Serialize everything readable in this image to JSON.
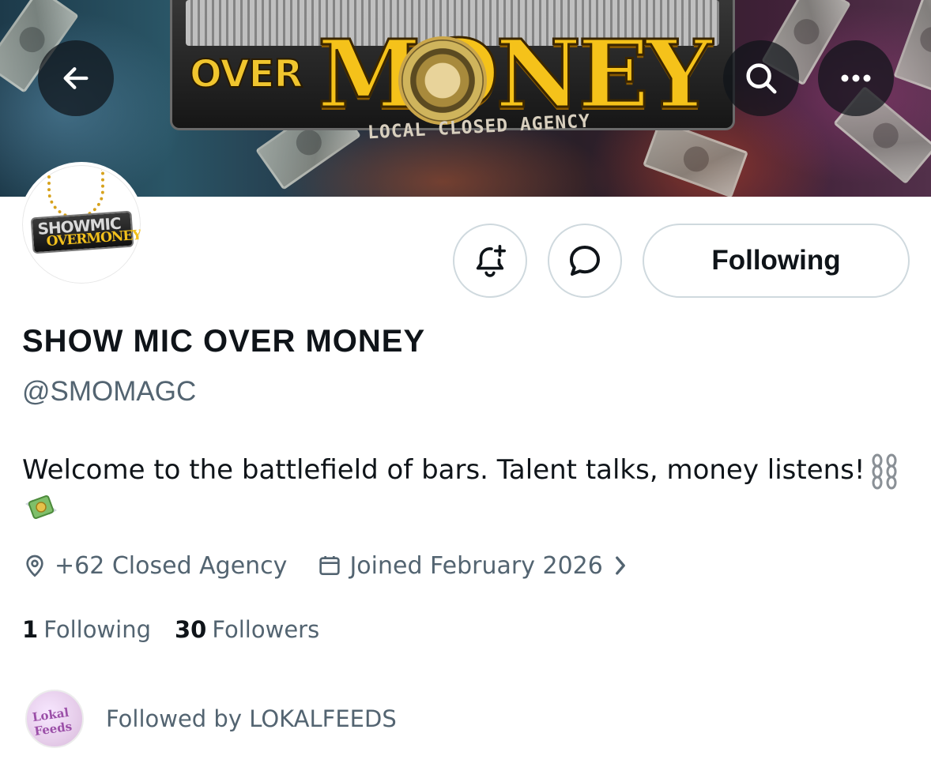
{
  "banner": {
    "logo_line_over": "OVER",
    "logo_line_money": "MONEY",
    "logo_subtitle": "LOCAL CLOSED AGENCY"
  },
  "nav": {
    "back_icon": "arrow-left-icon",
    "search_icon": "search-icon",
    "more_icon": "more-horizontal-icon"
  },
  "avatar": {
    "badge_top": "SHOWMIC",
    "badge_bottom": "OVERMONEY"
  },
  "actions": {
    "notify_icon": "bell-plus-icon",
    "message_icon": "chat-bubble-icon",
    "follow_label": "Following"
  },
  "profile": {
    "display_name": "SHOW MIC OVER MONEY",
    "handle": "@SMOMAGC",
    "bio": "Welcome to the battlefield of bars. Talent talks, money listens!",
    "bio_emojis": [
      "chains-emoji",
      "money-with-wings-emoji"
    ],
    "location": "+62 Closed Agency",
    "joined": "Joined February 2026"
  },
  "stats": {
    "following_count": "1",
    "following_label": "Following",
    "followers_count": "30",
    "followers_label": "Followers"
  },
  "followed_by": {
    "avatar_text": "Lokal Feeds",
    "text": "Followed by LOKALFEEDS"
  },
  "colors": {
    "text_primary": "#0f1419",
    "text_secondary": "#536471",
    "border": "#cfd9de",
    "brand_gold": "#f5c21a"
  }
}
